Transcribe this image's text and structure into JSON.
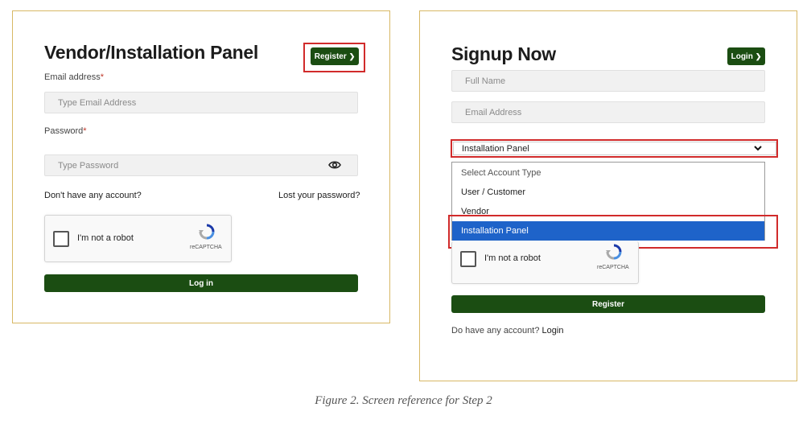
{
  "login_panel": {
    "title": "Vendor/Installation Panel",
    "register_button": "Register",
    "email_label": "Email address",
    "required_mark": "*",
    "email_placeholder": "Type Email Address",
    "password_label": "Password",
    "password_placeholder": "Type Password",
    "no_account_text": "Don't have any account?",
    "lost_password_link": "Lost your password?",
    "captcha_text": "I'm not a robot",
    "captcha_brand": "reCAPTCHA",
    "login_button": "Log in"
  },
  "signup_panel": {
    "title": "Signup Now",
    "login_button": "Login",
    "fullname_placeholder": "Full Name",
    "email_placeholder": "Email Address",
    "account_type_selected": "Installation Panel",
    "account_type_options": [
      "Select Account Type",
      "User / Customer",
      "Vendor",
      "Installation Panel"
    ],
    "captcha_text": "I'm not a robot",
    "captcha_brand": "reCAPTCHA",
    "register_button": "Register",
    "have_account_text": "Do have any account?",
    "login_link": "Login"
  },
  "caption": "Figure 2. Screen reference for Step 2",
  "colors": {
    "brand_green": "#1b4d12",
    "panel_border": "#d8b865",
    "highlight_red": "#d12b2b",
    "selected_blue": "#1e63c9"
  },
  "icons": {
    "password_toggle": "eye-icon",
    "button_chevron": "chevron-right-icon",
    "select_chevron": "chevron-down-icon",
    "captcha_logo": "recaptcha-icon"
  }
}
